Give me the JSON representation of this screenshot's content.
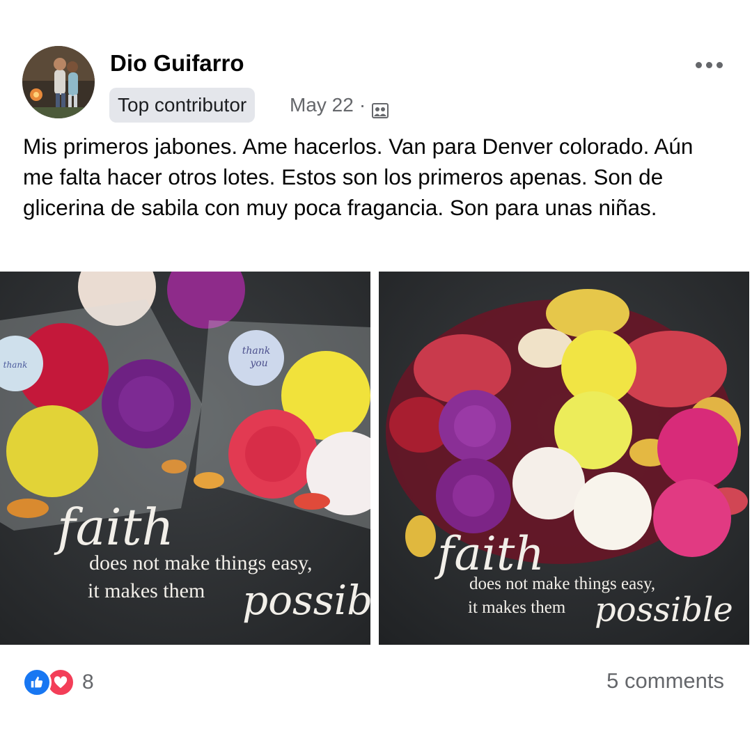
{
  "post": {
    "author": {
      "name": "Dio Guifarro",
      "badge": "Top contributor"
    },
    "date": "May 22",
    "separator": "·",
    "audience_icon": "group-icon",
    "more_icon": "more-horizontal-icon",
    "text": "Mis primeros jabones. Ame hacerlos. Van para Denver colorado. Aún me falta hacer otros lotes. Estos son los primeros apenas. Son de glicerina de sabila con muy poca fragancia. Son para unas niñas.",
    "photos": [
      {
        "sticker_text": "thank you",
        "quote_script_1": "faith",
        "quote_line_1": "does not make things easy,",
        "quote_line_2": "it makes them",
        "quote_script_2": "possib"
      },
      {
        "quote_script_1": "faith",
        "quote_line_1": "does not make things easy,",
        "quote_line_2": "it makes them",
        "quote_script_2": "possible"
      }
    ],
    "reactions": {
      "icons": [
        "like-icon",
        "love-icon"
      ],
      "count": "8"
    },
    "comments": "5 comments"
  },
  "colors": {
    "like": "#1877f2",
    "love": "#f33e58",
    "secondary_text": "#65676b",
    "badge_bg": "#e4e6eb"
  }
}
